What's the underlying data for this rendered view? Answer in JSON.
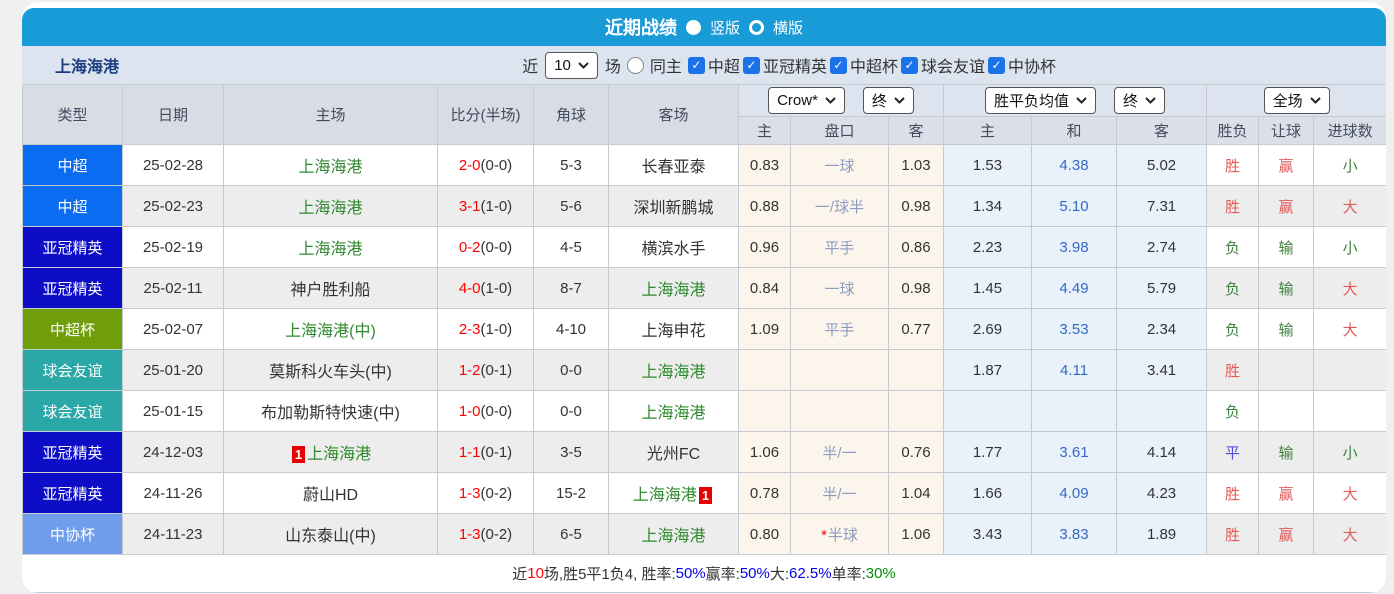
{
  "header": {
    "title": "近期战绩",
    "portrait_label": "竖版",
    "landscape_label": "横版"
  },
  "filter": {
    "team": "上海海港",
    "near_label": "近",
    "count": "10",
    "games_label": "场",
    "same_home_label": "同主",
    "leagues": [
      "中超",
      "亚冠精英",
      "中超杯",
      "球会友谊",
      "中协杯"
    ]
  },
  "table": {
    "columns": {
      "type": "类型",
      "date": "日期",
      "home": "主场",
      "score": "比分(半场)",
      "corner": "角球",
      "away": "客场"
    },
    "selects": {
      "asia_company": "Crow*",
      "asia_time": "终",
      "euro_type": "胜平负均值",
      "euro_time": "终",
      "scope": "全场"
    },
    "sub": [
      "主",
      "盘口",
      "客",
      "主",
      "和",
      "客",
      "胜负",
      "让球",
      "进球数"
    ],
    "rows": [
      {
        "league": "中超",
        "league_color": "#0a6cf1",
        "date": "25-02-28",
        "home": "上海海港",
        "home_green": true,
        "home_card": "",
        "score": "2-0",
        "half": "0-0",
        "corner": "5-3",
        "away": "长春亚泰",
        "away_green": false,
        "away_card": "",
        "asia_home": "0.83",
        "handicap": "一球",
        "handicap_star": false,
        "asia_away": "1.03",
        "euro_home": "1.53",
        "euro_draw": "4.38",
        "euro_away": "5.02",
        "result": "胜",
        "result_tone": "red",
        "cover": "赢",
        "cover_tone": "red",
        "goals": "小",
        "goals_tone": "green"
      },
      {
        "league": "中超",
        "league_color": "#0a6cf1",
        "date": "25-02-23",
        "home": "上海海港",
        "home_green": true,
        "home_card": "",
        "score": "3-1",
        "half": "1-0",
        "corner": "5-6",
        "away": "深圳新鹏城",
        "away_green": false,
        "away_card": "",
        "asia_home": "0.88",
        "handicap": "一/球半",
        "handicap_star": false,
        "asia_away": "0.98",
        "euro_home": "1.34",
        "euro_draw": "5.10",
        "euro_away": "7.31",
        "result": "胜",
        "result_tone": "red",
        "cover": "赢",
        "cover_tone": "red",
        "goals": "大",
        "goals_tone": "red"
      },
      {
        "league": "亚冠精英",
        "league_color": "#0d0dc8",
        "date": "25-02-19",
        "home": "上海海港",
        "home_green": true,
        "home_card": "",
        "score": "0-2",
        "half": "0-0",
        "corner": "4-5",
        "away": "横滨水手",
        "away_green": false,
        "away_card": "",
        "asia_home": "0.96",
        "handicap": "平手",
        "handicap_star": false,
        "asia_away": "0.86",
        "euro_home": "2.23",
        "euro_draw": "3.98",
        "euro_away": "2.74",
        "result": "负",
        "result_tone": "green",
        "cover": "输",
        "cover_tone": "green",
        "goals": "小",
        "goals_tone": "green"
      },
      {
        "league": "亚冠精英",
        "league_color": "#0d0dc8",
        "date": "25-02-11",
        "home": "神户胜利船",
        "home_green": false,
        "home_card": "",
        "score": "4-0",
        "half": "1-0",
        "corner": "8-7",
        "away": "上海海港",
        "away_green": true,
        "away_card": "",
        "asia_home": "0.84",
        "handicap": "一球",
        "handicap_star": false,
        "asia_away": "0.98",
        "euro_home": "1.45",
        "euro_draw": "4.49",
        "euro_away": "5.79",
        "result": "负",
        "result_tone": "green",
        "cover": "输",
        "cover_tone": "green",
        "goals": "大",
        "goals_tone": "red"
      },
      {
        "league": "中超杯",
        "league_color": "#6f9e0a",
        "date": "25-02-07",
        "home": "上海海港(中)",
        "home_green": true,
        "home_card": "",
        "score": "2-3",
        "half": "1-0",
        "corner": "4-10",
        "away": "上海申花",
        "away_green": false,
        "away_card": "",
        "asia_home": "1.09",
        "handicap": "平手",
        "handicap_star": false,
        "asia_away": "0.77",
        "euro_home": "2.69",
        "euro_draw": "3.53",
        "euro_away": "2.34",
        "result": "负",
        "result_tone": "green",
        "cover": "输",
        "cover_tone": "green",
        "goals": "大",
        "goals_tone": "red"
      },
      {
        "league": "球会友谊",
        "league_color": "#2aa8a8",
        "date": "25-01-20",
        "home": "莫斯科火车头(中)",
        "home_green": false,
        "home_card": "",
        "score": "1-2",
        "half": "0-1",
        "corner": "0-0",
        "away": "上海海港",
        "away_green": true,
        "away_card": "",
        "asia_home": "",
        "handicap": "",
        "handicap_star": false,
        "asia_away": "",
        "euro_home": "1.87",
        "euro_draw": "4.11",
        "euro_away": "3.41",
        "result": "胜",
        "result_tone": "red",
        "cover": "",
        "cover_tone": "",
        "goals": "",
        "goals_tone": ""
      },
      {
        "league": "球会友谊",
        "league_color": "#2aa8a8",
        "date": "25-01-15",
        "home": "布加勒斯特快速(中)",
        "home_green": false,
        "home_card": "",
        "score": "1-0",
        "half": "0-0",
        "corner": "0-0",
        "away": "上海海港",
        "away_green": true,
        "away_card": "",
        "asia_home": "",
        "handicap": "",
        "handicap_star": false,
        "asia_away": "",
        "euro_home": "",
        "euro_draw": "",
        "euro_away": "",
        "result": "负",
        "result_tone": "green",
        "cover": "",
        "cover_tone": "",
        "goals": "",
        "goals_tone": ""
      },
      {
        "league": "亚冠精英",
        "league_color": "#0d0dc8",
        "date": "24-12-03",
        "home": "上海海港",
        "home_green": true,
        "home_card": "1",
        "score": "1-1",
        "half": "0-1",
        "corner": "3-5",
        "away": "光州FC",
        "away_green": false,
        "away_card": "",
        "asia_home": "1.06",
        "handicap": "半/一",
        "handicap_star": false,
        "asia_away": "0.76",
        "euro_home": "1.77",
        "euro_draw": "3.61",
        "euro_away": "4.14",
        "result": "平",
        "result_tone": "blue",
        "cover": "输",
        "cover_tone": "green",
        "goals": "小",
        "goals_tone": "green"
      },
      {
        "league": "亚冠精英",
        "league_color": "#0d0dc8",
        "date": "24-11-26",
        "home": "蔚山HD",
        "home_green": false,
        "home_card": "",
        "score": "1-3",
        "half": "0-2",
        "corner": "15-2",
        "away": "上海海港",
        "away_green": true,
        "away_card": "1",
        "asia_home": "0.78",
        "handicap": "半/一",
        "handicap_star": false,
        "asia_away": "1.04",
        "euro_home": "1.66",
        "euro_draw": "4.09",
        "euro_away": "4.23",
        "result": "胜",
        "result_tone": "red",
        "cover": "赢",
        "cover_tone": "red",
        "goals": "大",
        "goals_tone": "red"
      },
      {
        "league": "中协杯",
        "league_color": "#6f9ceb",
        "date": "24-11-23",
        "home": "山东泰山(中)",
        "home_green": false,
        "home_card": "",
        "score": "1-3",
        "half": "0-2",
        "corner": "6-5",
        "away": "上海海港",
        "away_green": true,
        "away_card": "",
        "asia_home": "0.80",
        "handicap": "半球",
        "handicap_star": true,
        "asia_away": "1.06",
        "euro_home": "3.43",
        "euro_draw": "3.83",
        "euro_away": "1.89",
        "result": "胜",
        "result_tone": "red",
        "cover": "赢",
        "cover_tone": "red",
        "goals": "大",
        "goals_tone": "red"
      }
    ]
  },
  "footer": {
    "segments": [
      {
        "text": "近",
        "tone": "dark"
      },
      {
        "text": "10",
        "tone": "red"
      },
      {
        "text": "场,胜5平1负4, 胜率:",
        "tone": "dark"
      },
      {
        "text": "50%",
        "tone": "blue"
      },
      {
        "text": " 赢率:",
        "tone": "dark"
      },
      {
        "text": "50%",
        "tone": "blue"
      },
      {
        "text": " 大:",
        "tone": "dark"
      },
      {
        "text": "62.5%",
        "tone": "blue"
      },
      {
        "text": " 单率:",
        "tone": "dark"
      },
      {
        "text": "30%",
        "tone": "green"
      }
    ]
  },
  "colors": {
    "header_bar": "#199bd8",
    "filter_bar": "#dce4f0",
    "checkbox_on": "#1a73e8",
    "score_red": "#ff0000",
    "focus_team_green": "#2f8a2f",
    "asia_col_bg": "#fcf5ec",
    "euro_col_bg": "#e9f2fb"
  }
}
